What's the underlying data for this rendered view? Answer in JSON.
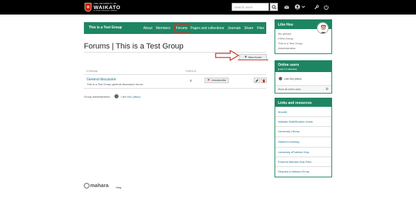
{
  "header": {
    "logo": {
      "line1": "THE UNIVERSITY OF",
      "line2": "WAIKATO",
      "line3": "Te Whare Wānanga o Waikato"
    },
    "search_placeholder": "Search users",
    "icons": [
      "envelope-icon",
      "user-icon",
      "chevron-down-icon",
      "wrench-icon",
      "logout-icon"
    ]
  },
  "group_nav": {
    "title": "This is a Test Group",
    "tabs": [
      "About",
      "Members",
      "Forums",
      "Pages and collections",
      "Journals",
      "Share",
      "Files"
    ],
    "active_tab": "Forums"
  },
  "main": {
    "title": "Forums | This is a Test Group",
    "new_forum_label": "New forum",
    "table": {
      "headers": [
        "FORUM",
        "TOPICS"
      ],
      "rows": [
        {
          "name": "General discussion",
          "description": "This is a Test Group general discussion forum",
          "topics": "0",
          "action": "Unsubscribe"
        }
      ]
    },
    "group_admins_label": "Group administrators:",
    "group_admin_name": "Libo Hou (libou)"
  },
  "sidebar": {
    "profile": {
      "name": "Libo Hou",
      "links": [
        "My groups:",
        "eTest Group",
        "This is a Test Group",
        "Administration"
      ]
    },
    "online_users": {
      "title": "Online users",
      "subtitle": "(Last 10 minutes)",
      "user": "Libo Hou (libou)",
      "show_all": "Show all online users"
    },
    "links_resources": {
      "title": "Links and resources",
      "items": [
        "Moodle",
        "Waikato Staff/Student Home",
        "University Library",
        "Student Learning",
        "University ePortfolio Help",
        "External Mahara Help Files",
        "Request a Mahara Group"
      ]
    }
  },
  "footer": {
    "brand": "mahara",
    "help": "Help"
  },
  "colors": {
    "topbar": "#000000",
    "accent": "#1e8563",
    "link": "#1e6e8a",
    "highlight": "#c0392b"
  }
}
